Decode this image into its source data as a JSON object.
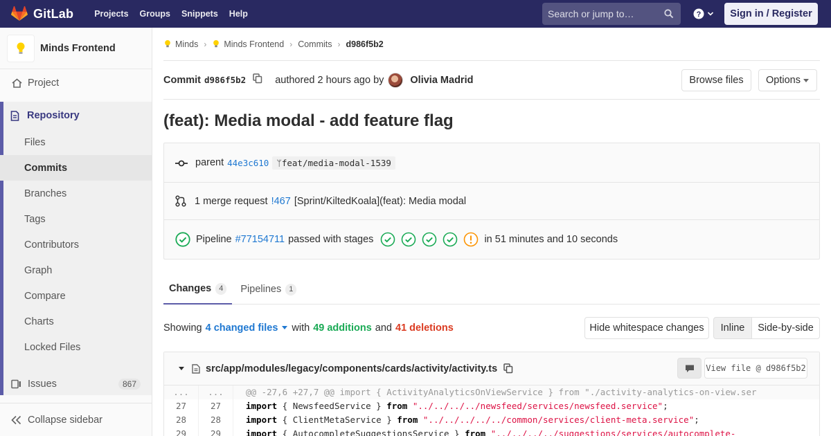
{
  "navbar": {
    "brand": "GitLab",
    "links": [
      "Projects",
      "Groups",
      "Snippets",
      "Help"
    ],
    "search_placeholder": "Search or jump to…",
    "sign_in": "Sign in / Register",
    "colors": {
      "navbar_bg": "#292961",
      "accent": "#fc6d26"
    }
  },
  "sidebar": {
    "project_name": "Minds Frontend",
    "project_label": "Project",
    "repository_label": "Repository",
    "repo_items": [
      "Files",
      "Commits",
      "Branches",
      "Tags",
      "Contributors",
      "Graph",
      "Compare",
      "Charts",
      "Locked Files"
    ],
    "active_item": "Commits",
    "issues_label": "Issues",
    "issues_count": "867",
    "collapse_label": "Collapse sidebar"
  },
  "breadcrumb": [
    "Minds",
    "Minds Frontend",
    "Commits",
    "d986f5b2"
  ],
  "commit": {
    "label": "Commit",
    "sha": "d986f5b2",
    "authored_text": "authored 2 hours ago by",
    "author": "Olivia Madrid",
    "browse_files": "Browse files",
    "options": "Options",
    "title": "(feat): Media modal - add feature flag",
    "parent_label": "parent",
    "parent_sha": "44e3c610",
    "branch": "feat/media-modal-1539",
    "merge_request_text": "1 merge request",
    "merge_request_id": "!467",
    "merge_request_title": "[Sprint/KiltedKoala](feat): Media modal",
    "pipeline_label": "Pipeline",
    "pipeline_id": "#77154711",
    "pipeline_status_text": "passed with stages",
    "pipeline_duration": "in 51 minutes and 10 seconds",
    "stages": [
      "passed",
      "passed",
      "passed",
      "passed",
      "warning"
    ]
  },
  "tabs": [
    {
      "label": "Changes",
      "count": "4"
    },
    {
      "label": "Pipelines",
      "count": "1"
    }
  ],
  "summary": {
    "showing": "Showing",
    "changed_files": "4 changed files",
    "with": "with",
    "additions": "49 additions",
    "and": "and",
    "deletions": "41 deletions",
    "hide_whitespace": "Hide whitespace changes",
    "inline": "Inline",
    "side_by_side": "Side-by-side"
  },
  "file": {
    "path": "src/app/modules/legacy/components/cards/activity/activity.ts",
    "view_file": "View file @ d986f5b2",
    "hunk": "@@ -27,6 +27,7 @@ import { ActivityAnalyticsOnViewService } from \"./activity-analytics-on-view.ser",
    "lines": [
      {
        "old": "27",
        "new": "27",
        "pre": "import",
        "mid": " { NewsfeedService } ",
        "from": "from",
        "str": "\"../../../../newsfeed/services/newsfeed.service\"",
        "end": ";"
      },
      {
        "old": "28",
        "new": "28",
        "pre": "import",
        "mid": " { ClientMetaService } ",
        "from": "from",
        "str": "\"../../../../../common/services/client-meta.service\"",
        "end": ";"
      },
      {
        "old": "29",
        "new": "29",
        "pre": "import",
        "mid": " { AutocompleteSuggestionsService } ",
        "from": "from",
        "str": "\"../../../../suggestions/services/autocomplete-",
        "end": ""
      }
    ]
  }
}
